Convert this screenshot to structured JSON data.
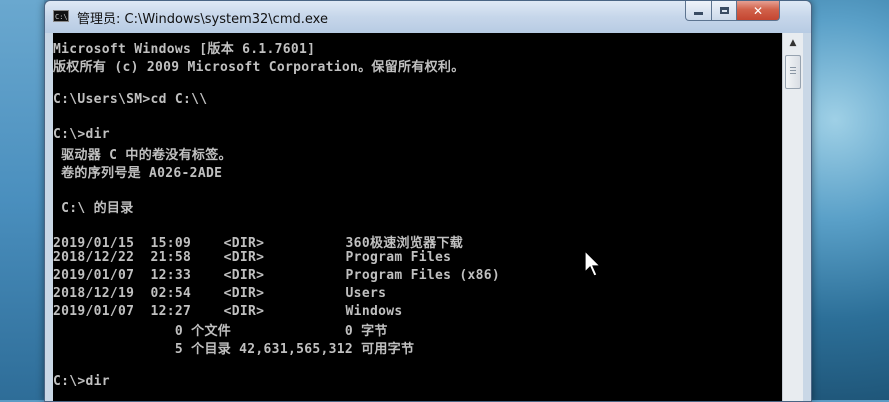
{
  "window": {
    "title": "管理员: C:\\Windows\\system32\\cmd.exe",
    "icon_label": "C:\\",
    "controls": {
      "minimize": "minimize",
      "maximize": "maximize",
      "close": "✕"
    }
  },
  "console": {
    "lines": [
      "Microsoft Windows [版本 6.1.7601]",
      "版权所有 (c) 2009 Microsoft Corporation。保留所有权利。",
      "",
      "C:\\Users\\SM>cd C:\\\\",
      "",
      "C:\\>dir",
      " 驱动器 C 中的卷没有标签。",
      " 卷的序列号是 A026-2ADE",
      "",
      " C:\\ 的目录",
      "",
      "2019/01/15  15:09    <DIR>          360极速浏览器下载",
      "2018/12/22  21:58    <DIR>          Program Files",
      "2019/01/07  12:33    <DIR>          Program Files (x86)",
      "2018/12/19  02:54    <DIR>          Users",
      "2019/01/07  12:27    <DIR>          Windows",
      "               0 个文件              0 字节",
      "               5 个目录 42,631,565,312 可用字节",
      "",
      "C:\\>dir"
    ]
  },
  "colors": {
    "console_bg": "#000000",
    "console_fg": "#c0c0c0",
    "close_button": "#c44631"
  },
  "icons": [
    "cmd-icon",
    "minimize-icon",
    "maximize-icon",
    "close-icon",
    "scroll-up-icon",
    "mouse-pointer-icon"
  ]
}
